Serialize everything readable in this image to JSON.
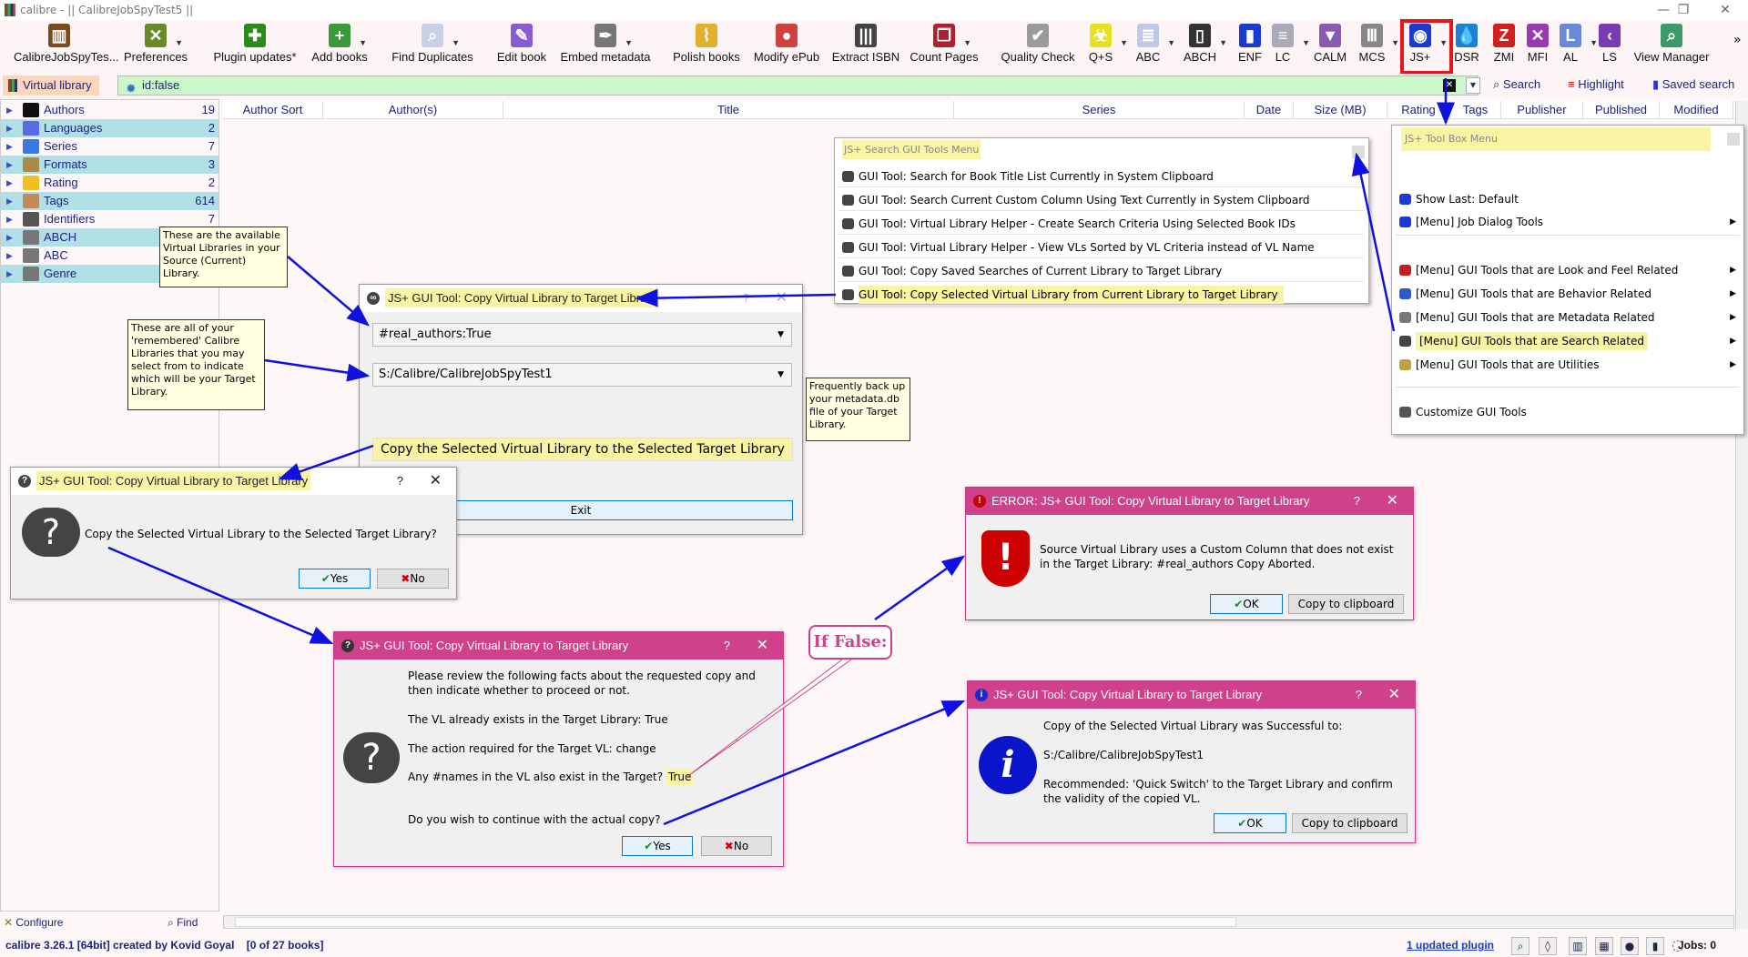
{
  "window": {
    "title": "calibre - || CalibreJobSpyTest5 ||",
    "minimize": "—",
    "restore": "❐",
    "close": "✕"
  },
  "toolbar": {
    "items": [
      {
        "label": "CalibreJobSpyTes...",
        "icon": "library-icon",
        "color": "#7a4a22",
        "glyph": "▥",
        "dropdown": false
      },
      {
        "label": "Preferences",
        "icon": "preferences-icon",
        "color": "#6a8a2a",
        "glyph": "✕",
        "dropdown": true
      },
      {
        "label": "Plugin updates*",
        "icon": "puzzle-icon",
        "color": "#2a8a1a",
        "glyph": "✚",
        "dropdown": false
      },
      {
        "label": "Add books",
        "icon": "add-books-icon",
        "color": "#3a9a3a",
        "glyph": "+",
        "dropdown": true
      },
      {
        "label": "Find Duplicates",
        "icon": "find-duplicates-icon",
        "color": "#c8d0e8",
        "glyph": "⌕",
        "dropdown": true
      },
      {
        "label": "Edit book",
        "icon": "edit-book-icon",
        "color": "#8a5ad0",
        "glyph": "✎",
        "dropdown": false
      },
      {
        "label": "Embed metadata",
        "icon": "quill-icon",
        "color": "#777",
        "glyph": "✒",
        "dropdown": true
      },
      {
        "label": "Polish books",
        "icon": "broom-icon",
        "color": "#e0b030",
        "glyph": "⌇",
        "dropdown": false
      },
      {
        "label": "Modify ePub",
        "icon": "modify-epub-icon",
        "color": "#d04040",
        "glyph": "●",
        "dropdown": false
      },
      {
        "label": "Extract ISBN",
        "icon": "barcode-icon",
        "color": "#444",
        "glyph": "|||",
        "dropdown": false
      },
      {
        "label": "Count Pages",
        "icon": "count-pages-icon",
        "color": "#b02030",
        "glyph": "❒",
        "dropdown": true
      },
      {
        "label": "Quality Check",
        "icon": "quality-check-icon",
        "color": "#9a9a9a",
        "glyph": "✔",
        "dropdown": false
      },
      {
        "label": "Q+S",
        "icon": "biohazard-icon",
        "color": "#e8e020",
        "glyph": "☣",
        "dropdown": true
      },
      {
        "label": "ABC",
        "icon": "abc-icon",
        "color": "#c0c8e8",
        "glyph": "≣",
        "dropdown": true
      },
      {
        "label": "ABCH",
        "icon": "abch-icon",
        "color": "#333",
        "glyph": "▯",
        "dropdown": true
      },
      {
        "label": "ENF",
        "icon": "chart-icon",
        "color": "#1a3ad0",
        "glyph": "▮",
        "dropdown": false
      },
      {
        "label": "LC",
        "icon": "ddc-icon",
        "color": "#aab",
        "glyph": "≡",
        "dropdown": true
      },
      {
        "label": "CALM",
        "icon": "funnel-icon",
        "color": "#8a5ab0",
        "glyph": "▼",
        "dropdown": false
      },
      {
        "label": "MCS",
        "icon": "column-icon",
        "color": "#888",
        "glyph": "Ⅲ",
        "dropdown": true
      },
      {
        "label": "JS+",
        "icon": "eye-icon",
        "color": "#1a3ad0",
        "glyph": "◉",
        "dropdown": true
      },
      {
        "label": "DSR",
        "icon": "drop-icon",
        "color": "#2080d0",
        "glyph": "💧",
        "dropdown": false
      },
      {
        "label": "ZMI",
        "icon": "z-icon",
        "color": "#d02020",
        "glyph": "Z",
        "dropdown": false
      },
      {
        "label": "MFI",
        "icon": "shuffle-icon",
        "color": "#9a3ab0",
        "glyph": "✕",
        "dropdown": false
      },
      {
        "label": "AL",
        "icon": "log-icon",
        "color": "#6a8ad8",
        "glyph": "L",
        "dropdown": true
      },
      {
        "label": "LS",
        "icon": "chevron-left-icon",
        "color": "#7a3ab0",
        "glyph": "‹",
        "dropdown": false
      },
      {
        "label": "View Manager",
        "icon": "view-manager-icon",
        "color": "#3a9a6a",
        "glyph": "⌕",
        "dropdown": false
      }
    ],
    "overflow": "»"
  },
  "searchbar": {
    "virtual_library": "Virtual library",
    "query": "id:false",
    "search": "Search",
    "highlight": "Highlight",
    "saved_search": "Saved search"
  },
  "tag_browser": {
    "items": [
      {
        "label": "Authors",
        "count": "19",
        "icon": "person-icon",
        "color": "#111"
      },
      {
        "label": "Languages",
        "count": "2",
        "icon": "languages-icon",
        "color": "#5a6ae0"
      },
      {
        "label": "Series",
        "count": "7",
        "icon": "series-icon",
        "color": "#3a7ae0"
      },
      {
        "label": "Formats",
        "count": "3",
        "icon": "book-icon",
        "color": "#a88a4a"
      },
      {
        "label": "Rating",
        "count": "2",
        "icon": "star-icon",
        "color": "#f0c020"
      },
      {
        "label": "Tags",
        "count": "614",
        "icon": "tag-icon",
        "color": "#c08a5a"
      },
      {
        "label": "Identifiers",
        "count": "7",
        "icon": "barcode-icon",
        "color": "#555"
      },
      {
        "label": "ABCH",
        "count": "",
        "icon": "column-icon",
        "color": "#777"
      },
      {
        "label": "ABC",
        "count": "",
        "icon": "column-icon",
        "color": "#777"
      },
      {
        "label": "Genre",
        "count": "",
        "icon": "column-icon",
        "color": "#777"
      }
    ],
    "configure": "Configure",
    "find": "Find"
  },
  "columns": [
    "Author Sort",
    "Author(s)",
    "Title",
    "Series",
    "Date",
    "Size (MB)",
    "Rating",
    "Tags",
    "Publisher",
    "Published",
    "Modified"
  ],
  "status": {
    "left": "calibre 3.26.1 [64bit] created by Kovid Goyal    [0 of 27 books]",
    "updated_plugin": "1 updated plugin",
    "jobs": "Jobs: 0"
  },
  "search_menu": {
    "title": "JS+ Search GUI Tools Menu",
    "items": [
      "GUI Tool:   Search for Book Title List Currently in System Clipboard",
      "GUI Tool:   Search Current Custom Column Using Text Currently in System Clipboard",
      "GUI Tool:   Virtual Library Helper - Create Search Criteria Using Selected Book IDs",
      "GUI Tool:   Virtual Library Helper - View VLs Sorted by VL Criteria instead of VL Name",
      "GUI Tool:   Copy Saved Searches of Current Library to Target Library",
      "GUI Tool:   Copy Selected Virtual Library from Current Library to Target Library"
    ]
  },
  "toolbox_menu": {
    "title": "JS+ Tool Box Menu",
    "items": [
      {
        "label": "Show Last: Default",
        "icon": "eye-icon",
        "color": "#1a3ad0",
        "sub": false
      },
      {
        "label": "[Menu] Job Dialog Tools",
        "icon": "eye-icon",
        "color": "#1a3ad0",
        "sub": true
      },
      {
        "label": "[Menu] GUI Tools that are Look and Feel Related",
        "icon": "brush-icon",
        "color": "#c02020",
        "sub": true
      },
      {
        "label": "[Menu] GUI Tools that are Behavior Related",
        "icon": "gear-icon",
        "color": "#2a5ad0",
        "sub": true
      },
      {
        "label": "[Menu] GUI Tools that are Metadata Related",
        "icon": "column-icon",
        "color": "#777",
        "sub": true
      },
      {
        "label": "[Menu] GUI Tools that are Search Related",
        "icon": "binoculars-icon",
        "color": "#444",
        "sub": true
      },
      {
        "label": "[Menu] GUI Tools that are Utilities",
        "icon": "wand-icon",
        "color": "#c0a040",
        "sub": true
      },
      {
        "label": "Customize GUI Tools",
        "icon": "tools-icon",
        "color": "#555",
        "sub": false
      }
    ]
  },
  "copy_vl_dialog": {
    "title": "JS+ GUI Tool: Copy Virtual Library to Target Library",
    "vl_value": "#real_authors:True",
    "target_value": "S:/Calibre/CalibreJobSpyTest1",
    "copy_button": "Copy the Selected Virtual Library to the Selected Target Library",
    "exit_button": "Exit"
  },
  "question_dialog": {
    "title": "JS+ GUI Tool: Copy Virtual Library to Target Library",
    "message": "Copy the Selected Virtual Library to the Selected Target Library?",
    "yes": "Yes",
    "no": "No"
  },
  "confirm_dialog": {
    "title": "JS+ GUI Tool: Copy Virtual Library to Target Library",
    "intro": "Please review the following facts about the requested copy and then indicate whether to proceed or not.",
    "exists": "The VL already exists in the Target Library: True",
    "action": "The action required for the Target VL: change",
    "names_label": "Any #names in the VL also exist in the Target?",
    "names_value": "True",
    "question": "Do you wish to continue with the actual copy?",
    "yes": "Yes",
    "no": "No"
  },
  "error_dialog": {
    "title": "ERROR: JS+ GUI Tool: Copy Virtual Library to Target Library",
    "message": "Source Virtual Library uses a Custom Column that does not exist in the Target Library: #real_authors  Copy Aborted.",
    "ok": "OK",
    "copy": "Copy to clipboard"
  },
  "info_dialog": {
    "title": "JS+ GUI Tool: Copy Virtual Library to Target Library",
    "line1": "Copy of the Selected Virtual Library was Successful to:",
    "path": "S:/Calibre/CalibreJobSpyTest1",
    "line2": "Recommended: 'Quick Switch' to the Target Library and confirm the validity of the copied VL.",
    "ok": "OK",
    "copy": "Copy to clipboard"
  },
  "annotations": {
    "vl_tip": "These are the available Virtual Libraries in your Source (Current) Library.",
    "libs_tip": "These are all of your 'remembered' Calibre Libraries that you may select from to indicate which will be your Target Library.",
    "backup_tip": "Frequently back up your metadata.db file of your Target Library.",
    "if_false": "If False:"
  },
  "colors": {
    "dialog_title": "#d0418b",
    "arrow": "#1010e0",
    "highlight_box": "#e8141c",
    "search_bg": "#ccf7cb",
    "highlight": "#f8f4a4"
  }
}
